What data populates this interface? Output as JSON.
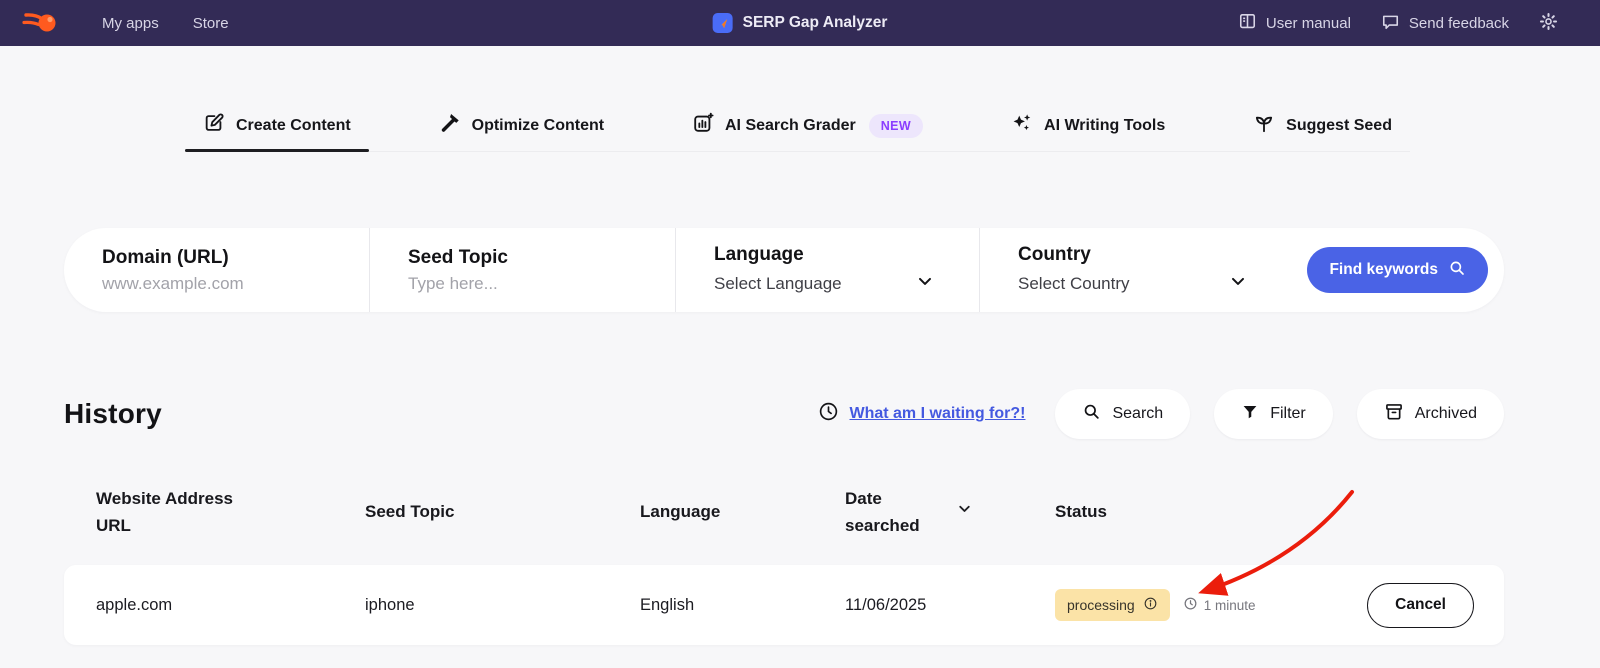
{
  "header": {
    "nav_my_apps": "My apps",
    "nav_store": "Store",
    "app_title": "SERP Gap Analyzer",
    "user_manual": "User manual",
    "send_feedback": "Send feedback"
  },
  "tabs": [
    {
      "label": "Create Content",
      "icon": "edit-pencil-icon",
      "active": true
    },
    {
      "label": "Optimize Content",
      "icon": "hammer-icon",
      "active": false
    },
    {
      "label": "AI Search Grader",
      "icon": "grader-chart-icon",
      "badge": "NEW",
      "active": false
    },
    {
      "label": "AI Writing Tools",
      "icon": "sparkles-icon",
      "active": false
    },
    {
      "label": "Suggest Seed",
      "icon": "sprout-icon",
      "active": false
    }
  ],
  "search_form": {
    "domain": {
      "label": "Domain (URL)",
      "placeholder": "www.example.com"
    },
    "seed": {
      "label": "Seed Topic",
      "placeholder": "Type here..."
    },
    "language": {
      "label": "Language",
      "value": "Select Language"
    },
    "country": {
      "label": "Country",
      "value": "Select Country"
    },
    "submit": "Find keywords"
  },
  "history": {
    "title": "History",
    "waiting_link": "What am I waiting for?!",
    "search": "Search",
    "filter": "Filter",
    "archived": "Archived"
  },
  "table": {
    "col_website": "Website Address URL",
    "col_seed": "Seed Topic",
    "col_language": "Language",
    "col_date": "Date searched",
    "col_status": "Status",
    "row": {
      "website": "apple.com",
      "seed": "iphone",
      "language": "English",
      "date": "11/06/2025",
      "status": "processing",
      "elapsed": "1 minute",
      "action": "Cancel"
    }
  },
  "colors": {
    "topbar_bg": "#332B56",
    "accent_blue": "#4A63E6",
    "app_icon_blue": "#4A6CF7",
    "new_badge_text": "#8B3DFF",
    "new_badge_bg": "#EDE6FC",
    "status_processing_bg": "#FBE3A7",
    "arrow_red": "#EB1D0C",
    "page_bg": "#F7F7F9"
  }
}
